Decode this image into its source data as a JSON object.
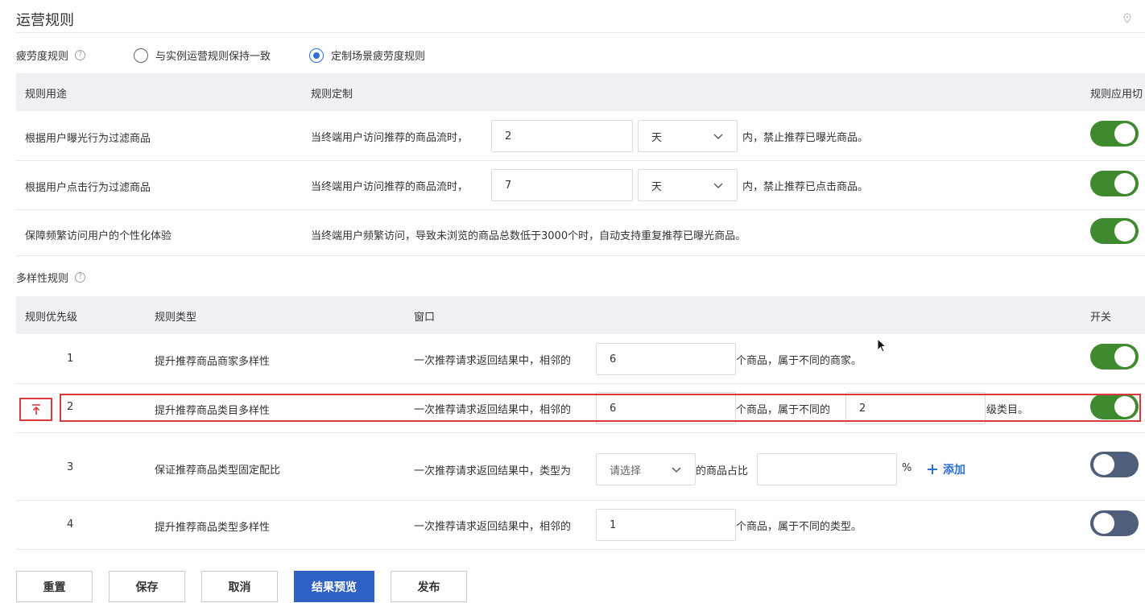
{
  "page": {
    "title": "运营规则"
  },
  "fatigue": {
    "label": "疲劳度规则",
    "help": "?",
    "options": [
      {
        "label": "与实例运营规则保持一致",
        "checked": false
      },
      {
        "label": "定制场景疲劳度规则",
        "checked": true
      }
    ],
    "headers": {
      "purpose": "规则用途",
      "rule": "规则定制",
      "apply": "规则应用切"
    },
    "rows": [
      {
        "purpose": "根据用户曝光行为过滤商品",
        "prefix": "当终端用户访问推荐的商品流时，",
        "value": "2",
        "unit": "天",
        "suffix": "内，禁止推荐已曝光商品。",
        "enabled": true
      },
      {
        "purpose": "根据用户点击行为过滤商品",
        "prefix": "当终端用户访问推荐的商品流时，",
        "value": "7",
        "unit": "天",
        "suffix": "内，禁止推荐已点击商品。",
        "enabled": true
      },
      {
        "purpose": "保障频繁访问用户的个性化体验",
        "text": "当终端用户频繁访问，导致未浏览的商品总数低于3000个时，自动支持重复推荐已曝光商品。",
        "enabled": true
      }
    ]
  },
  "diversity": {
    "label": "多样性规则",
    "help": "?",
    "headers": {
      "priority": "规则优先级",
      "type": "规则类型",
      "window": "窗口",
      "switch": "开关"
    },
    "rows": [
      {
        "priority": "1",
        "type": "提升推荐商品商家多样性",
        "prefix": "一次推荐请求返回结果中，相邻的",
        "value": "6",
        "suffix": "个商品，属于不同的商家。",
        "enabled": true
      },
      {
        "priority": "2",
        "type": "提升推荐商品类目多样性",
        "prefix": "一次推荐请求返回结果中，相邻的",
        "value": "6",
        "mid": "个商品，属于不同的",
        "value2": "2",
        "suffix": "级类目。",
        "enabled": true
      },
      {
        "priority": "3",
        "type": "保证推荐商品类型固定配比",
        "prefix": "一次推荐请求返回结果中，类型为",
        "select_placeholder": "请选择",
        "mid": "的商品占比",
        "value": "",
        "suffix": "%",
        "add": "添加",
        "enabled": false
      },
      {
        "priority": "4",
        "type": "提升推荐商品类型多样性",
        "prefix": "一次推荐请求返回结果中，相邻的",
        "value": "1",
        "suffix": "个商品，属于不同的类型。",
        "enabled": false
      }
    ]
  },
  "actions": {
    "reset": "重置",
    "save": "保存",
    "cancel": "取消",
    "preview": "结果预览",
    "publish": "发布"
  },
  "colors": {
    "primary": "#2f61c5",
    "switch_on": "#3f8a2f",
    "switch_off": "#4f5f7a",
    "highlight": "#d9393a"
  }
}
